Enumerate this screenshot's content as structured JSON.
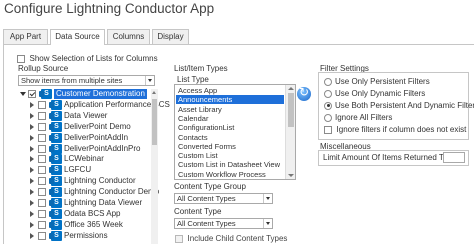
{
  "title": "Configure Lightning Conductor App",
  "tabs": [
    "App Part",
    "Data Source",
    "Columns",
    "Display"
  ],
  "active_tab": "Data Source",
  "show_selection_label": "Show Selection of Lists for Columns",
  "rollup_source": {
    "label": "Rollup Source",
    "scope_select": "Show items from multiple sites",
    "tree": [
      {
        "label": "Customer Demonstration",
        "checked": true,
        "selected": true,
        "expanded": true,
        "level": 0
      },
      {
        "label": "Application Performance BCS",
        "checked": false,
        "level": 1
      },
      {
        "label": "Data Viewer",
        "checked": false,
        "level": 1
      },
      {
        "label": "DeliverPoint Demo",
        "checked": false,
        "level": 1
      },
      {
        "label": "DeliverPointAddIn",
        "checked": false,
        "level": 1
      },
      {
        "label": "DeliverPointAddInPro",
        "checked": false,
        "level": 1
      },
      {
        "label": "LCWebinar",
        "checked": false,
        "level": 1
      },
      {
        "label": "LGFCU",
        "checked": false,
        "level": 1
      },
      {
        "label": "Lightning Conductor",
        "checked": false,
        "level": 1
      },
      {
        "label": "Lightning Conductor Demo",
        "checked": false,
        "level": 1
      },
      {
        "label": "Lightning Data Viewer",
        "checked": false,
        "level": 1
      },
      {
        "label": "Odata BCS App",
        "checked": false,
        "level": 1
      },
      {
        "label": "Office 365 Week",
        "checked": false,
        "level": 1
      },
      {
        "label": "Permissions",
        "checked": false,
        "level": 1
      }
    ]
  },
  "list_item_types": {
    "label": "List/Item Types",
    "list_type_label": "List Type",
    "list_types": [
      "Access App",
      "Announcements",
      "Asset Library",
      "Calendar",
      "ConfigurationList",
      "Contacts",
      "Converted Forms",
      "Custom List",
      "Custom List in Datasheet View",
      "Custom Workflow Process"
    ],
    "selected_list_type": "Announcements",
    "content_type_group_label": "Content Type Group",
    "content_type_group_value": "All Content Types",
    "content_type_label": "Content Type",
    "content_type_value": "All Content Types",
    "include_child_label": "Include Child Content Types"
  },
  "filter_settings": {
    "label": "Filter Settings",
    "options": [
      "Use Only Persistent Filters",
      "Use Only Dynamic Filters",
      "Use Both Persistent And Dynamic Filters",
      "Ignore All Filters"
    ],
    "selected_option": "Use Both Persistent And Dynamic Filters",
    "ignore_if_missing_label": "Ignore filters if column does not exist"
  },
  "miscellaneous": {
    "label": "Miscellaneous",
    "limit_label": "Limit Amount Of Items Returned To"
  },
  "colors": {
    "accent": "#1e6fd9",
    "sharepoint_blue": "#0072c6"
  }
}
